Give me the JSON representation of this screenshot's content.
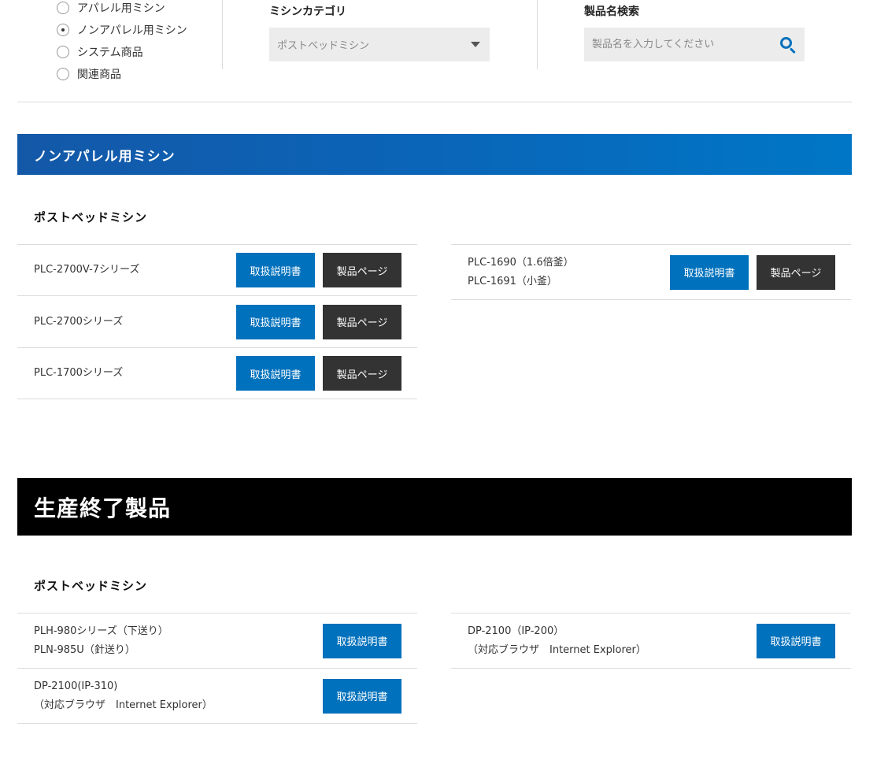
{
  "filter": {
    "radios": [
      {
        "label": "アパレル用ミシン",
        "checked": false
      },
      {
        "label": "ノンアパレル用ミシン",
        "checked": true
      },
      {
        "label": "システム商品",
        "checked": false
      },
      {
        "label": "関連商品",
        "checked": false
      }
    ],
    "category_label": "ミシンカテゴリ",
    "category_value": "ポストベッドミシン",
    "search_label": "製品名検索",
    "search_placeholder": "製品名を入力してください"
  },
  "section_current": {
    "title": "ノンアパレル用ミシン",
    "subtitle": "ポストベッドミシン",
    "left": [
      {
        "name": [
          "PLC-2700V-7シリーズ"
        ],
        "manual": "取扱説明書",
        "page": "製品ページ"
      },
      {
        "name": [
          "PLC-2700シリーズ"
        ],
        "manual": "取扱説明書",
        "page": "製品ページ"
      },
      {
        "name": [
          "PLC-1700シリーズ"
        ],
        "manual": "取扱説明書",
        "page": "製品ページ"
      }
    ],
    "right": [
      {
        "name": [
          "PLC-1690（1.6倍釜）",
          "PLC-1691（小釜）"
        ],
        "manual": "取扱説明書",
        "page": "製品ページ"
      }
    ]
  },
  "section_discontinued": {
    "title": "生産終了製品",
    "subtitle": "ポストベッドミシン",
    "left": [
      {
        "name": [
          "PLH-980シリーズ（下送り）",
          "PLN-985U（針送り）"
        ],
        "manual": "取扱説明書"
      },
      {
        "name": [
          "DP-2100(IP-310)",
          "（対応ブラウザ　Internet Explorer）"
        ],
        "manual": "取扱説明書"
      }
    ],
    "right": [
      {
        "name": [
          "DP-2100（IP-200）",
          "（対応ブラウザ　Internet Explorer）"
        ],
        "manual": "取扱説明書"
      }
    ]
  }
}
